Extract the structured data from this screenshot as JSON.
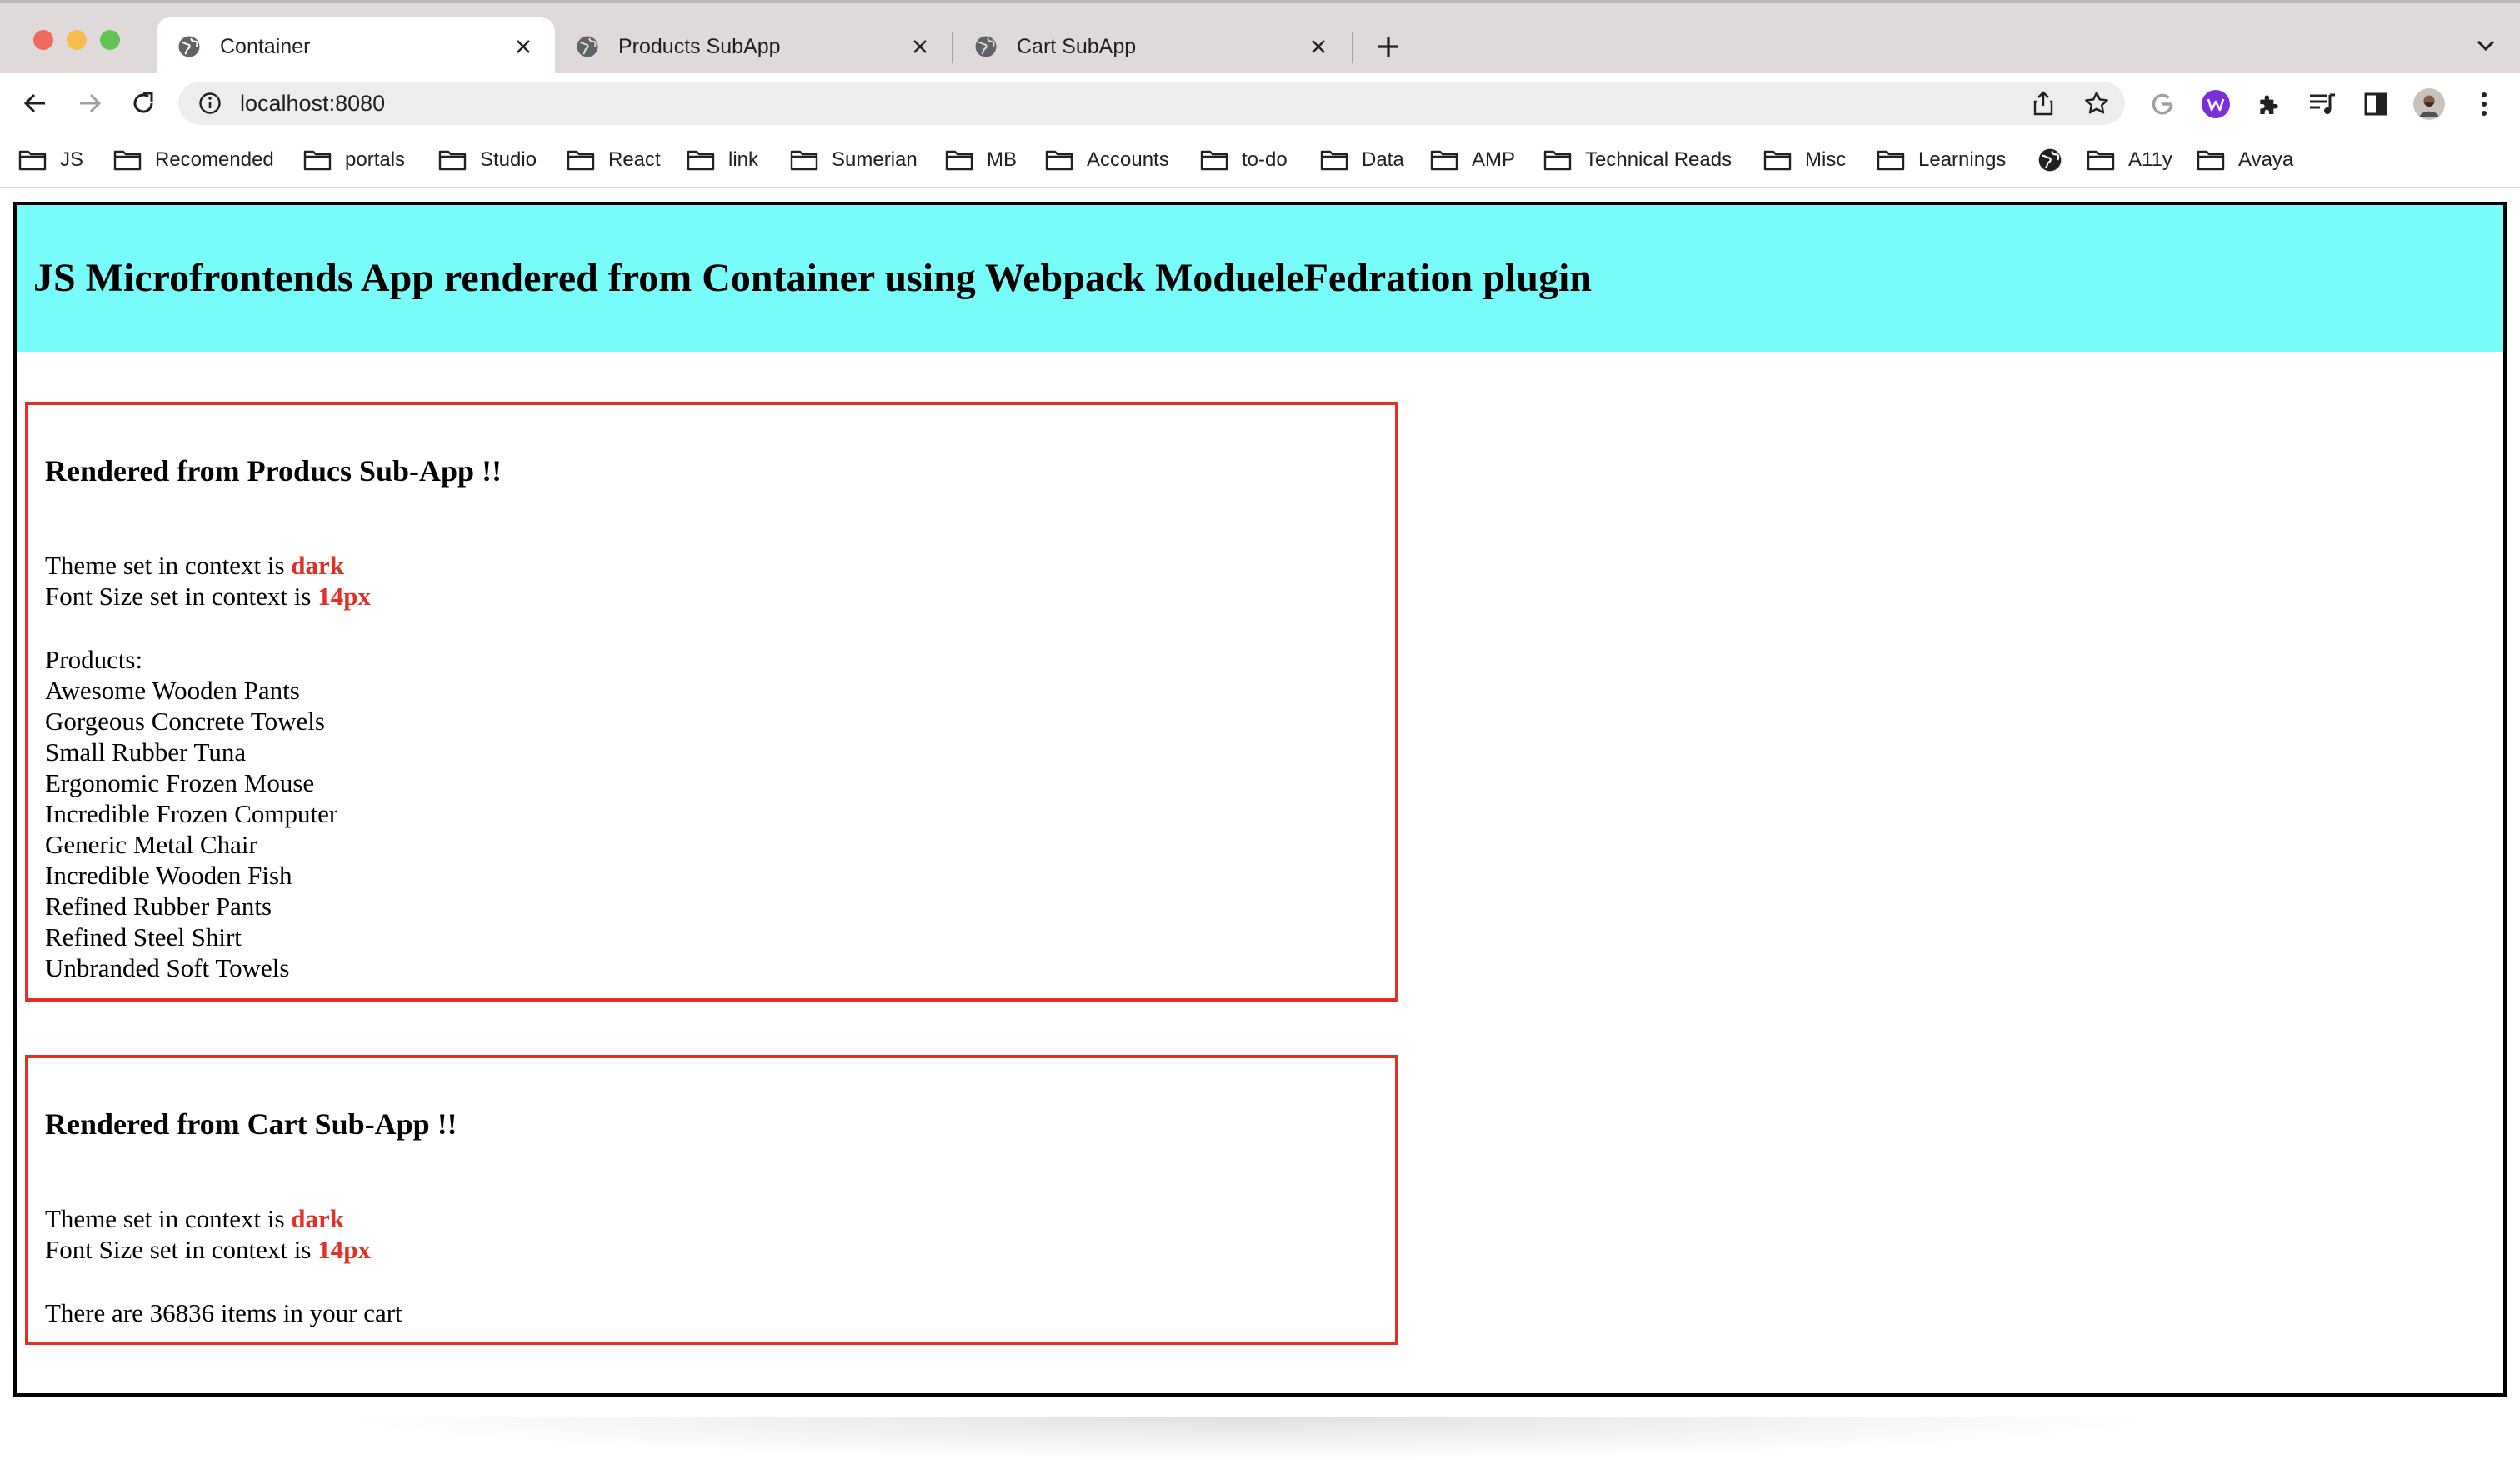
{
  "browser": {
    "tabs": [
      {
        "title": "Container",
        "active": true
      },
      {
        "title": "Products SubApp",
        "active": false
      },
      {
        "title": "Cart SubApp",
        "active": false
      }
    ],
    "url": "localhost:8080",
    "bookmarks": [
      "JS",
      "Recomended",
      "portals",
      "Studio",
      "React",
      "link",
      "Sumerian",
      "MB",
      "Accounts",
      "to-do",
      "Data",
      "AMP",
      "Technical Reads",
      "Misc",
      "Learnings",
      "A11y",
      "Avaya"
    ]
  },
  "page": {
    "title": "JS Microfrontends App rendered from Container using Webpack ModueleFedration plugin",
    "products_app": {
      "heading": "Rendered from Producs Sub-App !!",
      "theme_prefix": "Theme set in context is ",
      "theme_value": "dark",
      "font_prefix": "Font Size set in context is ",
      "font_value": "14px",
      "products_label": "Products:",
      "products": [
        "Awesome Wooden Pants",
        "Gorgeous Concrete Towels",
        "Small Rubber Tuna",
        "Ergonomic Frozen Mouse",
        "Incredible Frozen Computer",
        "Generic Metal Chair",
        "Incredible Wooden Fish",
        "Refined Rubber Pants",
        "Refined Steel Shirt",
        "Unbranded Soft Towels"
      ]
    },
    "cart_app": {
      "heading": "Rendered from Cart Sub-App !!",
      "theme_prefix": "Theme set in context is ",
      "theme_value": "dark",
      "font_prefix": "Font Size set in context is ",
      "font_value": "14px",
      "cart_text": "There are 36836 items in your cart"
    }
  },
  "colors": {
    "header_bg": "#78fcfa",
    "accent_red": "#e03127"
  }
}
